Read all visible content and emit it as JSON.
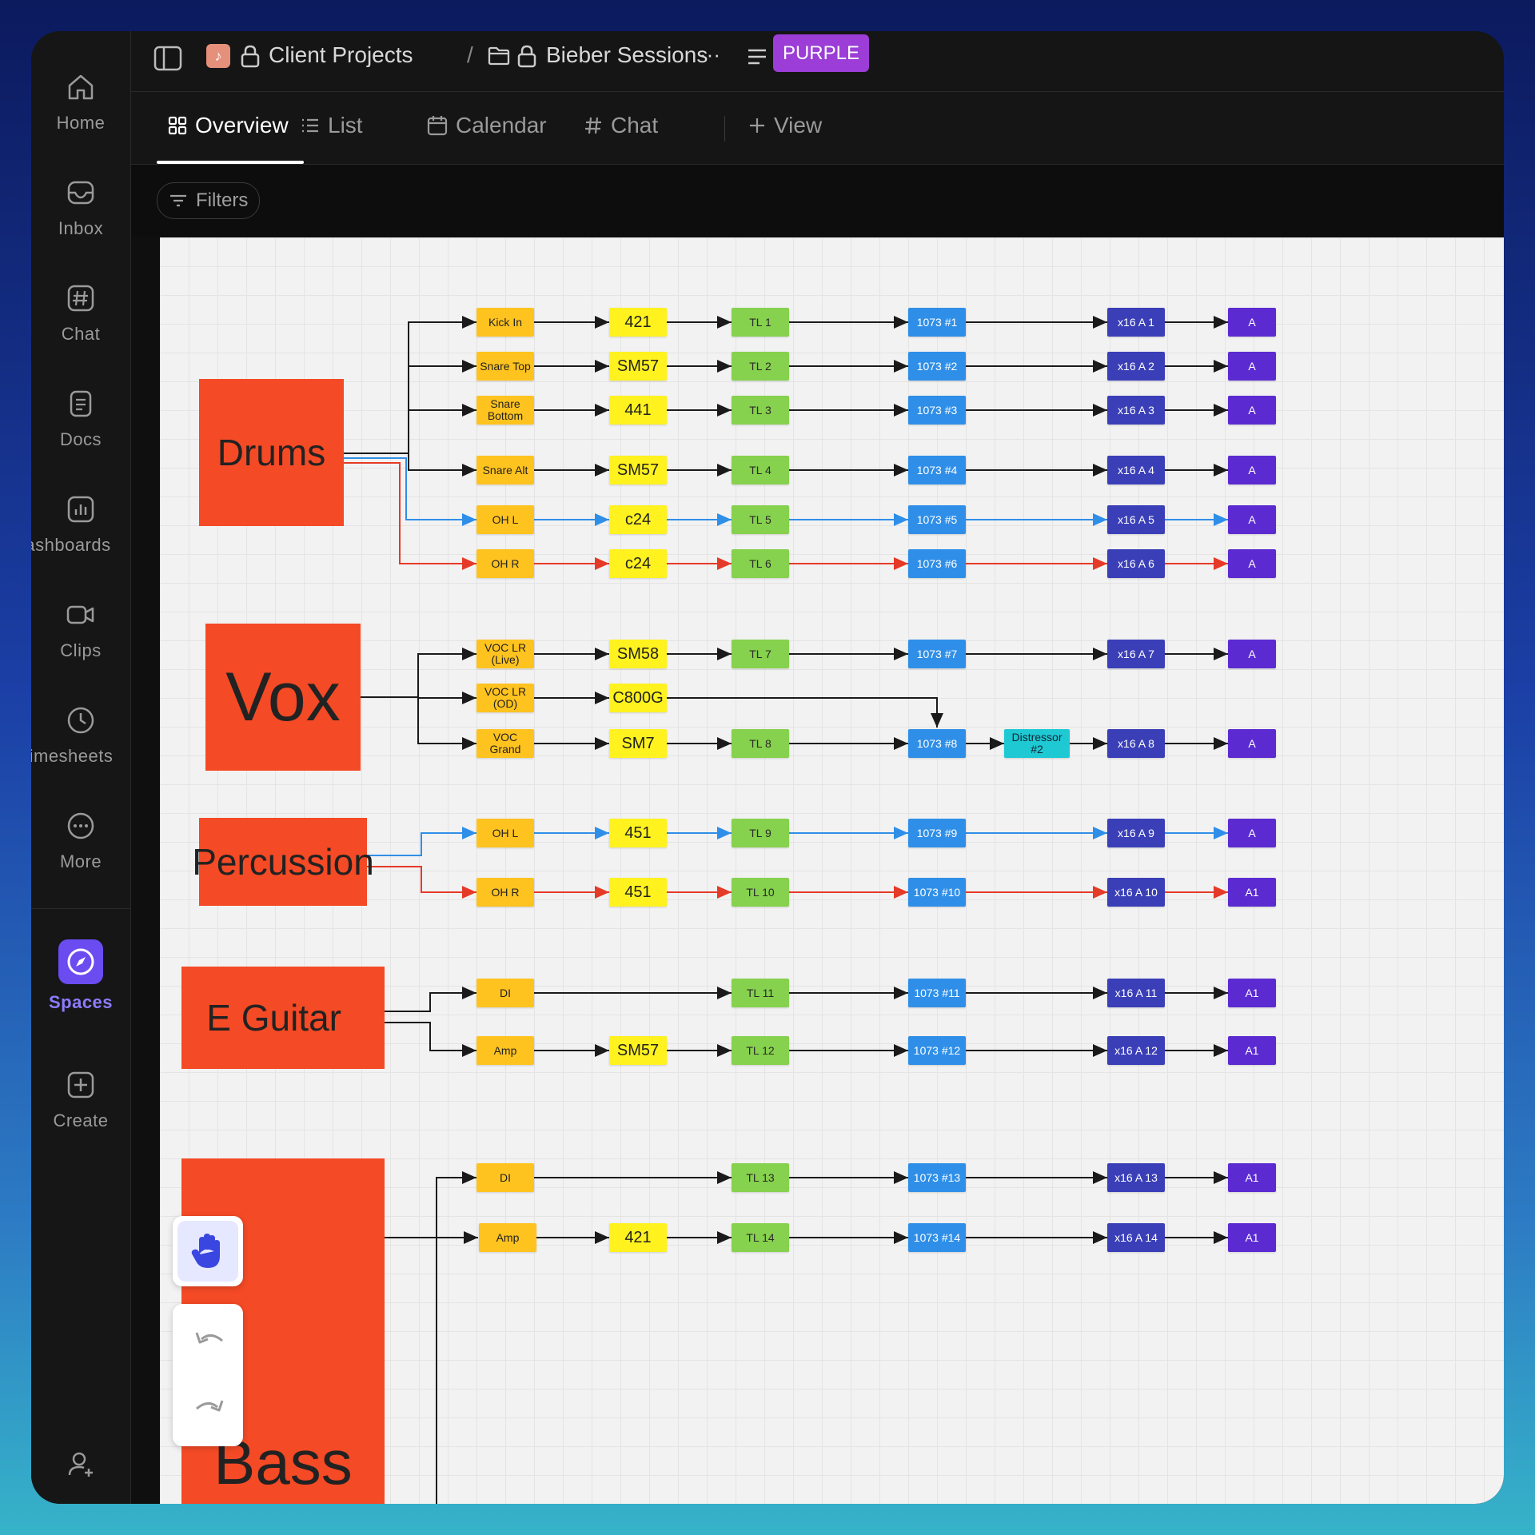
{
  "sidebar": {
    "items": [
      {
        "label": "Home",
        "icon": "home-icon"
      },
      {
        "label": "Inbox",
        "icon": "inbox-icon"
      },
      {
        "label": "Chat",
        "icon": "hash-icon"
      },
      {
        "label": "Docs",
        "icon": "doc-icon"
      },
      {
        "label": "ashboards",
        "icon": "bar-chart-icon"
      },
      {
        "label": "Clips",
        "icon": "video-icon"
      },
      {
        "label": "imesheets",
        "icon": "clock-icon"
      },
      {
        "label": "More",
        "icon": "more-icon"
      }
    ],
    "spaces_label": "Spaces",
    "create_label": "Create"
  },
  "breadcrumb": {
    "space": "Client Projects",
    "separator": "/",
    "folder": "Bieber Sessions",
    "more": "···",
    "badge": "PURPLE"
  },
  "tabs": [
    {
      "label": "Overview",
      "icon": "grid-icon",
      "active": true
    },
    {
      "label": "List",
      "icon": "list-icon"
    },
    {
      "label": "Calendar",
      "icon": "calendar-icon"
    },
    {
      "label": "Chat",
      "icon": "hash-icon"
    },
    {
      "label": "View",
      "icon": "plus-icon"
    }
  ],
  "filters_label": "Filters",
  "colors": {
    "group": "#f44a25",
    "source": "#ffc31f",
    "mic": "#fff21f",
    "tl": "#86d14d",
    "pre": "#2f8fe8",
    "distressor": "#1ec9d3",
    "input": "#3a3fb8",
    "out": "#5b2bd1",
    "wire_black": "#1a1a1a",
    "wire_blue": "#2f8fe8",
    "wire_red": "#e53a28",
    "badge": "#9b3dd6"
  },
  "diagram": {
    "groups": [
      "Drums",
      "Vox",
      "Percussion",
      "E Guitar",
      "Bass"
    ],
    "sources": [
      "Kick In",
      "Snare Top",
      "Snare Bottom",
      "Snare Alt",
      "OH L",
      "OH R",
      "VOC LR (Live)",
      "VOC LR (OD)",
      "VOC Grand",
      "OH L",
      "OH R",
      "DI",
      "Amp",
      "DI",
      "Amp"
    ],
    "mics": [
      "421",
      "SM57",
      "441",
      "SM57",
      "c24",
      "c24",
      "SM58",
      "C800G",
      "SM7",
      "451",
      "451",
      "SM57",
      "421"
    ],
    "tl": [
      "TL 1",
      "TL 2",
      "TL 3",
      "TL 4",
      "TL 5",
      "TL 6",
      "TL 7",
      "TL 8",
      "TL 9",
      "TL 10",
      "TL 11",
      "TL 12",
      "TL 13",
      "TL 14"
    ],
    "pre": [
      "1073 #1",
      "1073 #2",
      "1073 #3",
      "1073 #4",
      "1073 #5",
      "1073 #6",
      "1073 #7",
      "1073 #8",
      "1073 #9",
      "1073 #10",
      "1073 #11",
      "1073 #12",
      "1073 #13",
      "1073 #14"
    ],
    "distressor": "Distressor #2",
    "inputs": [
      "x16 A 1",
      "x16 A 2",
      "x16 A 3",
      "x16 A 4",
      "x16 A 5",
      "x16 A 6",
      "x16 A 7",
      "x16 A 8",
      "x16 A 9",
      "x16 A 10",
      "x16 A 11",
      "x16 A 12",
      "x16 A 13",
      "x16 A 14"
    ],
    "outs": [
      "A",
      "A",
      "A",
      "A",
      "A",
      "A",
      "A",
      "A",
      "A",
      "A1",
      "A1",
      "A1",
      "A1",
      "A1"
    ]
  }
}
